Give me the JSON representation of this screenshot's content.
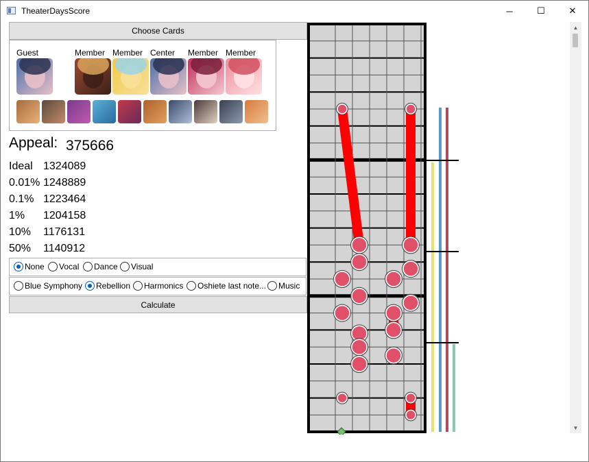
{
  "window": {
    "title": "TheaterDaysScore",
    "controls": {
      "minimize": "─",
      "maximize": "☐",
      "close": "✕"
    }
  },
  "choose_cards_label": "Choose Cards",
  "team": {
    "roles": [
      "Guest",
      "Member",
      "Member",
      "Center",
      "Member",
      "Member"
    ],
    "card_colors": [
      {
        "bg": "#4d6fa8",
        "fg": "#2c3150",
        "accent": "#e8c0c8"
      },
      {
        "bg": "#9a4a30",
        "fg": "#d9a35a",
        "accent": "#3c2018"
      },
      {
        "bg": "#f1c94a",
        "fg": "#9bd3e8",
        "accent": "#f7e09a"
      },
      {
        "bg": "#4d6fa8",
        "fg": "#2c3150",
        "accent": "#e8c0c8"
      },
      {
        "bg": "#c0305a",
        "fg": "#7a1f3a",
        "accent": "#f4c8d0"
      },
      {
        "bg": "#f08d9a",
        "fg": "#d15060",
        "accent": "#ffe2e4"
      }
    ],
    "support_colors": [
      {
        "bg": "#a86b3c",
        "fg": "#e8b37a"
      },
      {
        "bg": "#5a4a3a",
        "fg": "#c48a6a"
      },
      {
        "bg": "#7a3a8a",
        "fg": "#c05ab0"
      },
      {
        "bg": "#5ab0d8",
        "fg": "#2a6aa0"
      },
      {
        "bg": "#c03a4a",
        "fg": "#6a2a5a"
      },
      {
        "bg": "#b0602a",
        "fg": "#e0a060"
      },
      {
        "bg": "#3a4a6a",
        "fg": "#b0c0d8"
      },
      {
        "bg": "#4a3a3a",
        "fg": "#e0d0c0"
      },
      {
        "bg": "#3a4050",
        "fg": "#8a9ab0"
      },
      {
        "bg": "#d87a3a",
        "fg": "#f0c090"
      }
    ]
  },
  "appeal": {
    "label": "Appeal:",
    "value": "375666"
  },
  "scores": [
    {
      "label": "Ideal",
      "value": "1324089"
    },
    {
      "label": "0.01%",
      "value": "1248889"
    },
    {
      "label": "0.1%",
      "value": "1223464"
    },
    {
      "label": "1%",
      "value": "1204158"
    },
    {
      "label": "10%",
      "value": "1176131"
    },
    {
      "label": "50%",
      "value": "1140912"
    }
  ],
  "appeal_options": [
    "None",
    "Vocal",
    "Dance",
    "Visual"
  ],
  "appeal_selected": "None",
  "songs": [
    "Blue Symphony",
    "Rebellion",
    "Harmonics",
    "Oshiete last note...",
    "Music"
  ],
  "song_selected": "Rebellion",
  "calculate_label": "Calculate",
  "accent_color": "#005fb8",
  "chart": {
    "lanes": 6,
    "note_color": "#e05068",
    "hold_color": "#ff0000",
    "lane_bg": "#d4d4d4",
    "notes": [
      {
        "lane": 1,
        "row": 5
      },
      {
        "lane": 5,
        "row": 5
      },
      {
        "lane": 2,
        "row": 13
      },
      {
        "lane": 5,
        "row": 13
      },
      {
        "lane": 2,
        "row": 14
      },
      {
        "lane": 1,
        "row": 15
      },
      {
        "lane": 4,
        "row": 15
      },
      {
        "lane": 5,
        "row": 14.4
      },
      {
        "lane": 2,
        "row": 16
      },
      {
        "lane": 5,
        "row": 16.4
      },
      {
        "lane": 1,
        "row": 17
      },
      {
        "lane": 4,
        "row": 17
      },
      {
        "lane": 4,
        "row": 18
      },
      {
        "lane": 2,
        "row": 18.2
      },
      {
        "lane": 2,
        "row": 19
      },
      {
        "lane": 4,
        "row": 19.5
      },
      {
        "lane": 2,
        "row": 20
      },
      {
        "lane": 1,
        "row": 22
      },
      {
        "lane": 5,
        "row": 22
      },
      {
        "lane": 5,
        "row": 23
      }
    ],
    "holds": [
      {
        "lane_a": 1,
        "row_a": 5,
        "lane_b": 2,
        "row_b": 13
      },
      {
        "lane_a": 5,
        "row_a": 5,
        "lane_b": 5,
        "row_b": 13
      },
      {
        "lane_a": 4,
        "row_a": 17,
        "lane_b": 4,
        "row_b": 18
      },
      {
        "lane_a": 2,
        "row_a": 18.2,
        "lane_b": 2,
        "row_b": 19
      },
      {
        "lane_a": 5,
        "row_a": 22,
        "lane_b": 5,
        "row_b": 23
      }
    ],
    "gauge_colors": [
      "#e8e070",
      "#5a9ad0",
      "#b04a60",
      "#8ac8b0"
    ]
  }
}
